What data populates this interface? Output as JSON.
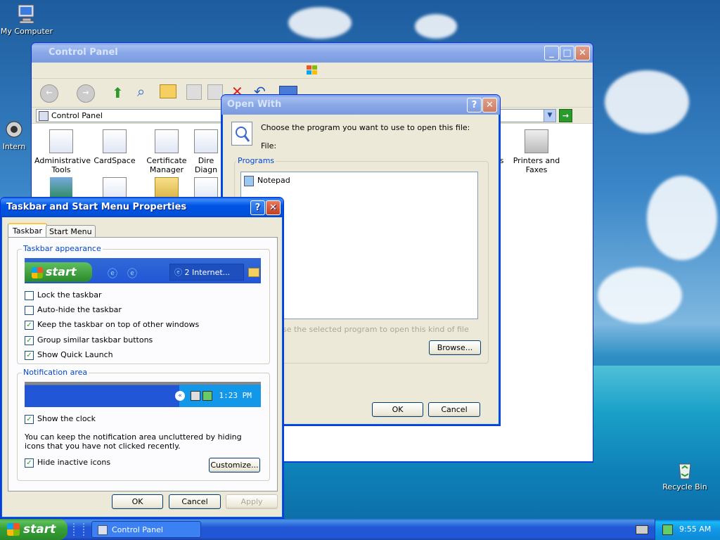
{
  "desktop": {
    "icons": [
      {
        "label": "My Computer"
      },
      {
        "label": "Intern"
      },
      {
        "label": "Recycle Bin"
      }
    ]
  },
  "control_panel": {
    "title": "Control Panel",
    "address": "Control Panel",
    "items": [
      {
        "label": "Administrative Tools"
      },
      {
        "label": "CardSpace"
      },
      {
        "label": "Certificate Manager"
      },
      {
        "label": "Dire Diagn"
      },
      {
        "label": "Printers and Faxes"
      },
      {
        "label": "ns"
      }
    ]
  },
  "open_with": {
    "title": "Open With",
    "prompt": "Choose the program you want to use to open this file:",
    "file_label": "File:",
    "programs_group": "Programs",
    "programs": [
      "Notepad"
    ],
    "always_use_text": "se the selected program to open this kind of file",
    "browse_label": "Browse...",
    "ok_label": "OK",
    "cancel_label": "Cancel"
  },
  "taskbar_props": {
    "title": "Taskbar and Start Menu Properties",
    "tabs": [
      {
        "label": "Taskbar",
        "active": true
      },
      {
        "label": "Start Menu",
        "active": false
      }
    ],
    "appearance_group": "Taskbar appearance",
    "preview_start": "start",
    "preview_task": "2 Internet...",
    "options": [
      {
        "label": "Lock the taskbar",
        "checked": false
      },
      {
        "label": "Auto-hide the taskbar",
        "checked": false
      },
      {
        "label": "Keep the taskbar on top of other windows",
        "checked": true
      },
      {
        "label": "Group similar taskbar buttons",
        "checked": true
      },
      {
        "label": "Show Quick Launch",
        "checked": true
      }
    ],
    "notification_group": "Notification area",
    "preview_time": "1:23 PM",
    "show_clock": {
      "label": "Show the clock",
      "checked": true
    },
    "notification_text": "You can keep the notification area uncluttered by hiding icons that you have not clicked recently.",
    "hide_inactive": {
      "label": "Hide inactive icons",
      "checked": true
    },
    "customize_label": "Customize...",
    "ok_label": "OK",
    "cancel_label": "Cancel",
    "apply_label": "Apply"
  },
  "taskbar": {
    "start_label": "start",
    "tasks": [
      {
        "label": "Control Panel"
      }
    ],
    "clock": "9:55 AM"
  }
}
